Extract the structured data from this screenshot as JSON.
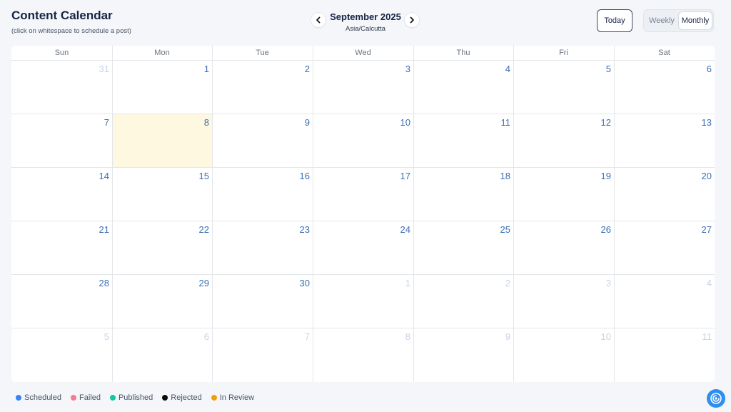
{
  "header": {
    "title": "Content Calendar",
    "subtitle": "(click on whitespace to schedule a post)",
    "month_label": "September 2025",
    "timezone": "Asia/Calcutta",
    "today_label": "Today",
    "view_weekly": "Weekly",
    "view_monthly": "Monthly",
    "active_view": "Monthly"
  },
  "calendar": {
    "weekdays": [
      "Sun",
      "Mon",
      "Tue",
      "Wed",
      "Thu",
      "Fri",
      "Sat"
    ],
    "weeks": [
      [
        {
          "d": "31",
          "cur": false
        },
        {
          "d": "1",
          "cur": true
        },
        {
          "d": "2",
          "cur": true
        },
        {
          "d": "3",
          "cur": true
        },
        {
          "d": "4",
          "cur": true
        },
        {
          "d": "5",
          "cur": true
        },
        {
          "d": "6",
          "cur": true
        }
      ],
      [
        {
          "d": "7",
          "cur": true
        },
        {
          "d": "8",
          "cur": true,
          "today": true
        },
        {
          "d": "9",
          "cur": true
        },
        {
          "d": "10",
          "cur": true
        },
        {
          "d": "11",
          "cur": true
        },
        {
          "d": "12",
          "cur": true
        },
        {
          "d": "13",
          "cur": true
        }
      ],
      [
        {
          "d": "14",
          "cur": true
        },
        {
          "d": "15",
          "cur": true
        },
        {
          "d": "16",
          "cur": true
        },
        {
          "d": "17",
          "cur": true
        },
        {
          "d": "18",
          "cur": true
        },
        {
          "d": "19",
          "cur": true
        },
        {
          "d": "20",
          "cur": true
        }
      ],
      [
        {
          "d": "21",
          "cur": true
        },
        {
          "d": "22",
          "cur": true
        },
        {
          "d": "23",
          "cur": true
        },
        {
          "d": "24",
          "cur": true
        },
        {
          "d": "25",
          "cur": true
        },
        {
          "d": "26",
          "cur": true
        },
        {
          "d": "27",
          "cur": true
        }
      ],
      [
        {
          "d": "28",
          "cur": true
        },
        {
          "d": "29",
          "cur": true
        },
        {
          "d": "30",
          "cur": true
        },
        {
          "d": "1",
          "cur": false
        },
        {
          "d": "2",
          "cur": false
        },
        {
          "d": "3",
          "cur": false
        },
        {
          "d": "4",
          "cur": false
        }
      ],
      [
        {
          "d": "5",
          "cur": false
        },
        {
          "d": "6",
          "cur": false
        },
        {
          "d": "7",
          "cur": false
        },
        {
          "d": "8",
          "cur": false
        },
        {
          "d": "9",
          "cur": false
        },
        {
          "d": "10",
          "cur": false
        },
        {
          "d": "11",
          "cur": false
        }
      ]
    ]
  },
  "legend": [
    {
      "label": "Scheduled",
      "color": "#3b82f6"
    },
    {
      "label": "Failed",
      "color": "#f47a94"
    },
    {
      "label": "Published",
      "color": "#10c9a0"
    },
    {
      "label": "Rejected",
      "color": "#0b0b0b"
    },
    {
      "label": "In Review",
      "color": "#f59e0b"
    }
  ],
  "colors": {
    "accent": "#3b6fb6",
    "today_highlight": "#fef8e1",
    "fab": "#2f8ff0"
  },
  "icons": {
    "prev": "chevron-left-icon",
    "next": "chevron-right-icon",
    "fab": "assistant-spiral-icon"
  }
}
